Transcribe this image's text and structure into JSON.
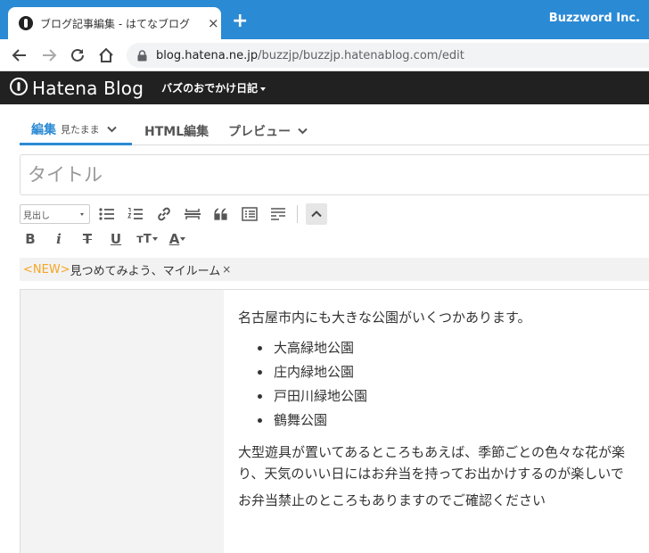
{
  "browser": {
    "tab_title": "ブログ記事編集 - はてなブログ",
    "close_symbol": "×",
    "new_tab_symbol": "+",
    "profile_name": "Buzzword Inc.",
    "url_host": "blog.hatena.ne.jp",
    "url_path": "/buzzjp/buzzjp.hatenablog.com/edit"
  },
  "hatena_header": {
    "logo_text": "Hatena Blog",
    "blog_name": "バズのおでかけ日記"
  },
  "editor_tabs": [
    {
      "label": "編集",
      "sublabel": "見たまま"
    },
    {
      "label": "HTML編集"
    },
    {
      "label": "プレビュー"
    }
  ],
  "title_input": {
    "placeholder": "タイトル",
    "value": ""
  },
  "toolbar": {
    "heading_select": "見出し",
    "icons_row1": [
      "bulleted-list-icon",
      "numbered-list-icon",
      "link-icon",
      "horizontal-rule-icon",
      "quote-icon",
      "table-of-contents-icon",
      "read-more-icon",
      "collapse-toolbar-icon"
    ],
    "icons_row2": [
      "bold-icon",
      "italic-icon",
      "strikethrough-icon",
      "underline-icon",
      "font-size-icon",
      "text-color-icon"
    ],
    "bold": "B",
    "italic": "i",
    "strike": "T",
    "underline": "U",
    "fontsize": "тT",
    "color": "A"
  },
  "category": {
    "prefix": "<NEW>",
    "label": "見つめてみよう、マイルーム",
    "remove": "×"
  },
  "body": {
    "intro": "名古屋市内にも大きな公園がいくつかあります。",
    "parks": [
      "大高緑地公園",
      "庄内緑地公園",
      "戸田川緑地公園",
      "鶴舞公園"
    ],
    "para1_line1": "大型遊具が置いてあるところもあえば、季節ごとの色々な花が楽",
    "para1_line2": "り、天気のいい日にはお弁当を持ってお出かけするのが楽しいで",
    "para2": "お弁当禁止のところもありますのでご確認ください"
  },
  "colors": {
    "chrome_blue": "#2b8ad4",
    "hatena_header": "#212121",
    "active_tab": "#2b8ad4",
    "new_tag": "#f5a623"
  }
}
